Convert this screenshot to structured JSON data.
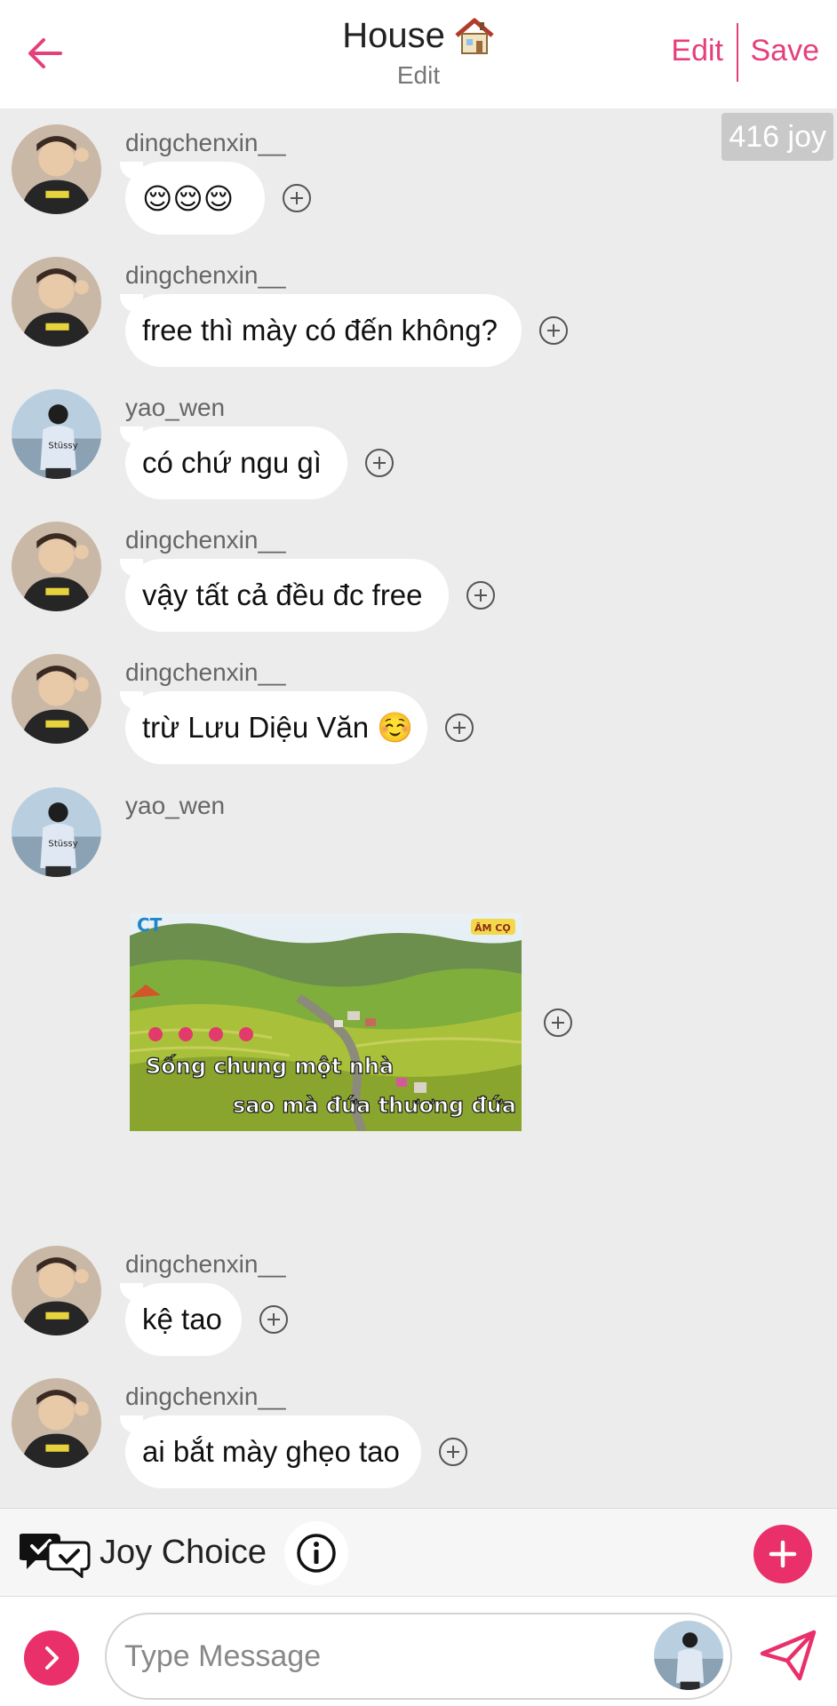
{
  "header": {
    "title": "House",
    "title_icon": "house-icon",
    "subtitle": "Edit",
    "edit_label": "Edit",
    "save_label": "Save"
  },
  "joy_badge": "416 joy",
  "messages": [
    {
      "user": "dingchenxin__",
      "avatar": "dingchenxin",
      "text": "😌😌😌"
    },
    {
      "user": "dingchenxin__",
      "avatar": "dingchenxin",
      "text": "free thì mày có đến không?"
    },
    {
      "user": "yao_wen",
      "avatar": "yao_wen",
      "text": "có chứ ngu gì"
    },
    {
      "user": "dingchenxin__",
      "avatar": "dingchenxin",
      "text": "vậy tất cả đều đc free"
    },
    {
      "user": "dingchenxin__",
      "avatar": "dingchenxin",
      "text": "trừ Lưu Diệu Văn ☺️"
    },
    {
      "user": "yao_wen",
      "avatar": "yao_wen",
      "type": "sticker",
      "sticker": {
        "line1": "Sống chung một nhà",
        "line2": "sao mà đứa thương đứa ghét",
        "corner_left": "CT",
        "corner_right": "ÂM CỌ"
      }
    },
    {
      "user": "dingchenxin__",
      "avatar": "dingchenxin",
      "text": "kệ tao"
    },
    {
      "user": "dingchenxin__",
      "avatar": "dingchenxin",
      "text": "ai bắt mày ghẹo tao"
    }
  ],
  "joy_choice": {
    "label": "Joy Choice",
    "icon": "chat-hearts-icon",
    "info_icon": "info-icon",
    "add_icon": "plus-icon"
  },
  "composer": {
    "placeholder": "Type Message",
    "expand_icon": "chevron-right-icon",
    "send_icon": "send-icon"
  },
  "colors": {
    "accent": "#e9306b",
    "header_link": "#e4407b",
    "background": "#ececec",
    "bubble": "#ffffff"
  }
}
